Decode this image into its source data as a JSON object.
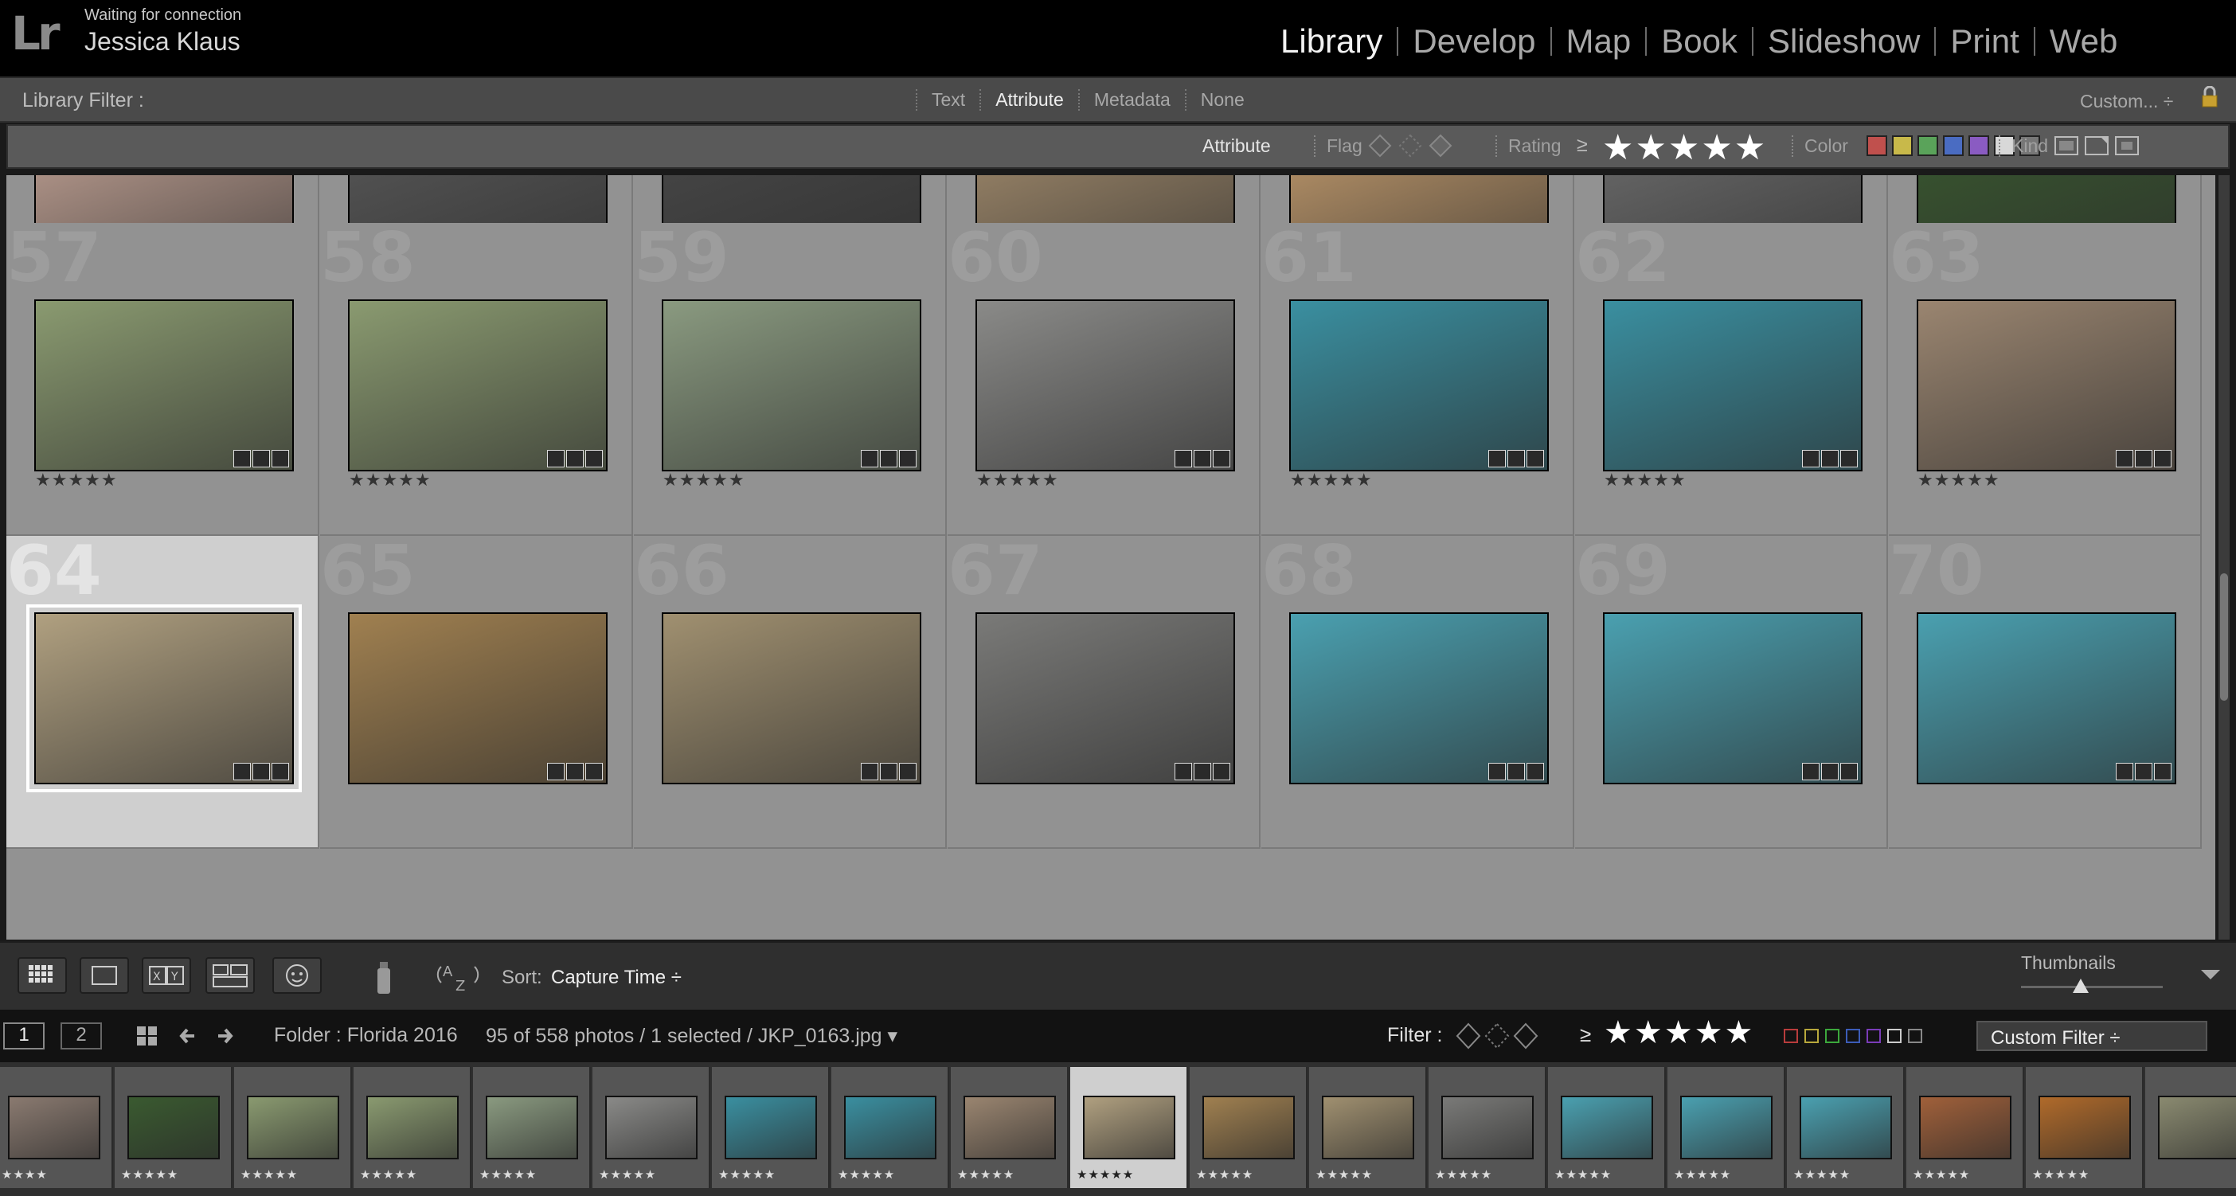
{
  "app": {
    "logo": "Lr",
    "status": "Waiting for connection",
    "user": "Jessica Klaus"
  },
  "modules": [
    {
      "label": "Library",
      "active": true
    },
    {
      "label": "Develop"
    },
    {
      "label": "Map"
    },
    {
      "label": "Book"
    },
    {
      "label": "Slideshow"
    },
    {
      "label": "Print"
    },
    {
      "label": "Web"
    }
  ],
  "library_filter": {
    "title": "Library Filter :",
    "tabs": [
      "Text",
      "Attribute",
      "Metadata",
      "None"
    ],
    "active_tab": "Attribute",
    "custom": "Custom... ÷"
  },
  "attribute_bar": {
    "attribute": "Attribute",
    "flag": "Flag",
    "rating": "Rating",
    "rating_op": "≥",
    "rating_stars": "★★★★★",
    "color": "Color",
    "kind": "Kind",
    "colors": [
      "#c0504d",
      "#c8b94a",
      "#5aa35a",
      "#4a6cc2",
      "#8a5bc2",
      "#d8d8d8",
      "#777777"
    ]
  },
  "grid": {
    "rows": [
      {
        "cells": [
          {
            "num": "",
            "stars": "★★★★★",
            "tone": "#c9a89a"
          },
          {
            "num": "",
            "stars": "★★★★★",
            "tone": "#5a5a5a"
          },
          {
            "num": "",
            "stars": "★★★★★",
            "tone": "#4a4a4a"
          },
          {
            "num": "",
            "stars": "★★★★★",
            "tone": "#a89070"
          },
          {
            "num": "",
            "stars": "★★★★★",
            "tone": "#c9a070"
          },
          {
            "num": "",
            "stars": "★★★★★",
            "tone": "#707070"
          },
          {
            "num": "",
            "stars": "★★★★★",
            "tone": "#3a5a30"
          }
        ]
      },
      {
        "cells": [
          {
            "num": "57",
            "stars": "★★★★★",
            "tone": "#8a9a70"
          },
          {
            "num": "58",
            "stars": "★★★★★",
            "tone": "#8a9a70"
          },
          {
            "num": "59",
            "stars": "★★★★★",
            "tone": "#8a9a80"
          },
          {
            "num": "60",
            "stars": "★★★★★",
            "tone": "#8a8a88"
          },
          {
            "num": "61",
            "stars": "★★★★★",
            "tone": "#3a8fa0"
          },
          {
            "num": "62",
            "stars": "★★★★★",
            "tone": "#3a8fa0"
          },
          {
            "num": "63",
            "stars": "★★★★★",
            "tone": "#9a8570"
          }
        ]
      },
      {
        "cells": [
          {
            "num": "64",
            "stars": "",
            "tone": "#b0a080",
            "selected": true
          },
          {
            "num": "65",
            "stars": "",
            "tone": "#a08050"
          },
          {
            "num": "66",
            "stars": "",
            "tone": "#a09070"
          },
          {
            "num": "67",
            "stars": "",
            "tone": "#7a7a78"
          },
          {
            "num": "68",
            "stars": "",
            "tone": "#4aa0b0"
          },
          {
            "num": "69",
            "stars": "",
            "tone": "#4aa0b0"
          },
          {
            "num": "70",
            "stars": "",
            "tone": "#4aa0b0"
          }
        ]
      }
    ]
  },
  "toolbar": {
    "sort_label": "Sort:",
    "sort_value": "Capture Time ÷",
    "thumbnails_label": "Thumbnails",
    "thumbnail_size": 0.42
  },
  "filmstrip_bar": {
    "nav1": "1",
    "nav2": "2",
    "folder": "Folder : Florida 2016",
    "count": "95 of 558 photos / 1 selected / JKP_0163.jpg ▾",
    "filter_label": "Filter :",
    "filter_op": "≥",
    "filter_stars": "★★★★★",
    "custom_filter": "Custom Filter ÷",
    "color_boxes": [
      "#b83c3c",
      "#b8a83c",
      "#3ca83c",
      "#3c5cb8",
      "#7a3cb8",
      "#cccccc",
      "#888888"
    ]
  },
  "filmstrip": [
    {
      "tone": "#8a7a70",
      "stars": "★★★★"
    },
    {
      "tone": "#3a5a30",
      "stars": "★★★★★"
    },
    {
      "tone": "#8a9a70",
      "stars": "★★★★★"
    },
    {
      "tone": "#8a9a70",
      "stars": "★★★★★"
    },
    {
      "tone": "#8a9a80",
      "stars": "★★★★★"
    },
    {
      "tone": "#8a8a88",
      "stars": "★★★★★"
    },
    {
      "tone": "#3a8fa0",
      "stars": "★★★★★"
    },
    {
      "tone": "#3a8fa0",
      "stars": "★★★★★"
    },
    {
      "tone": "#9a8570",
      "stars": "★★★★★"
    },
    {
      "tone": "#b0a080",
      "stars": "★★★★★",
      "selected": true
    },
    {
      "tone": "#a08050",
      "stars": "★★★★★"
    },
    {
      "tone": "#a09070",
      "stars": "★★★★★"
    },
    {
      "tone": "#7a7a78",
      "stars": "★★★★★"
    },
    {
      "tone": "#4aa0b0",
      "stars": "★★★★★"
    },
    {
      "tone": "#4aa0b0",
      "stars": "★★★★★"
    },
    {
      "tone": "#4aa0b0",
      "stars": "★★★★★"
    },
    {
      "tone": "#a0603a",
      "stars": "★★★★★"
    },
    {
      "tone": "#b06a2a",
      "stars": "★★★★★"
    },
    {
      "tone": "#8a8a70",
      "stars": ""
    }
  ]
}
